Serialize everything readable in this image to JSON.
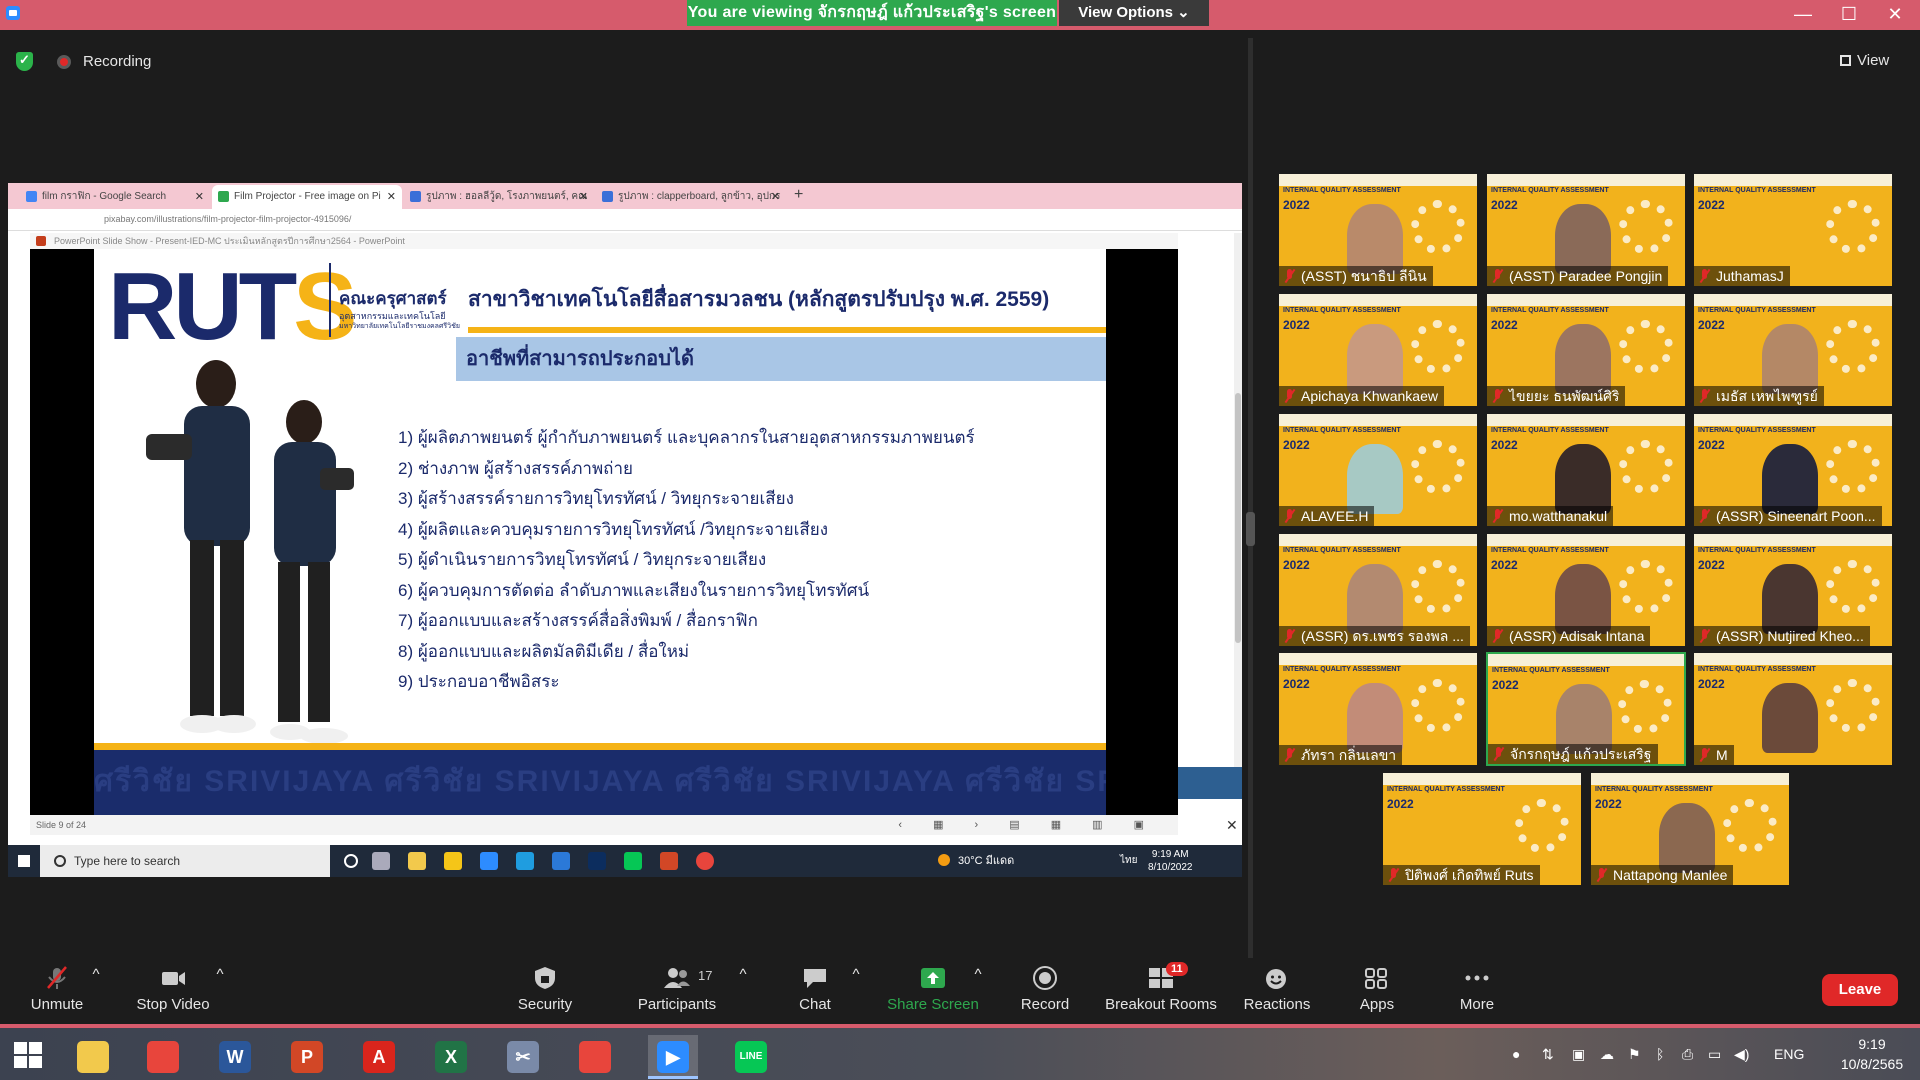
{
  "window": {
    "viewing_banner": "You are viewing จักรกฤษฎ์ แก้วประเสริฐ's screen",
    "view_options": "View Options"
  },
  "meeting": {
    "recording_label": "Recording",
    "view_label": "View"
  },
  "shared_screen": {
    "browser_tabs": [
      {
        "label": "film กราฟิก - Google Search",
        "icon_color": "#4285f4"
      },
      {
        "label": "Film Projector - Free image on Pi",
        "icon_color": "#2ea84e"
      },
      {
        "label": "รูปภาพ : ฮอลลีวู้ด, โรงภาพยนตร์, คณ",
        "icon_color": "#3b6fd8"
      },
      {
        "label": "รูปภาพ : clapperboard, ลูกข้าว, อุปกร",
        "icon_color": "#3b6fd8"
      }
    ],
    "address": "pixabay.com/illustrations/film-projector-film-projector-4915096/",
    "ppt_title": "PowerPoint Slide Show - Present-IED-MC ประเมินหลักสูตรปีการศึกษา2564 - PowerPoint",
    "slide": {
      "logo_main": "RUT",
      "logo_accent": "S",
      "faculty_title": "คณะครุศาสตร์",
      "faculty_sub": "อุตสาหกรรมและเทคโนโลยี",
      "faculty_uni": "มหาวิทยาลัยเทคโนโลยีราชมงคลศรีวิชัย",
      "program_title": "สาขาวิชาเทคโนโลยีสื่อสารมวลชน (หลักสูตรปรับปรุง พ.ศ. 2559)",
      "careers_heading": "อาชีพที่สามารถประกอบได้",
      "careers": [
        "1) ผู้ผลิตภาพยนตร์ ผู้กำกับภาพยนตร์ และบุคลากรในสายอุตสาหกรรมภาพยนตร์",
        "2) ช่างภาพ ผู้สร้างสรรค์ภาพถ่าย",
        "3) ผู้สร้างสรรค์รายการวิทยุโทรทัศน์ / วิทยุกระจายเสียง",
        "4) ผู้ผลิตและควบคุมรายการวิทยุโทรทัศน์ /วิทยุกระจายเสียง",
        "5) ผู้ดำเนินรายการวิทยุโทรทัศน์ / วิทยุกระจายเสียง",
        "6) ผู้ควบคุมการตัดต่อ ลำดับภาพและเสียงในรายการวิทยุโทรทัศน์",
        "7) ผู้ออกแบบและสร้างสรรค์สื่อสิ่งพิมพ์ / สื่อกราฟิก",
        "8) ผู้ออกแบบและผลิตมัลติมีเดีย / สื่อใหม่",
        "9) ประกอบอาชีพอิสระ"
      ],
      "watermark": "ศรีวิชัย SRIVIJAYA ศรีวิชัย SRIVIJAYA ศรีวิชัย SRIVIJAYA ศรีวิชัย SRIVIJAYA"
    },
    "slide_counter": "Slide 9 of 24",
    "inner_taskbar": {
      "search_placeholder": "Type here to search",
      "weather": "30°C มีแดด",
      "lang": "ไทย",
      "time": "9:19 AM",
      "date": "8/10/2022"
    }
  },
  "participants": [
    {
      "name": "(ASST) ชนาธิป ลีนิน",
      "skin": "#b98a6a",
      "active": false
    },
    {
      "name": "(ASST) Paradee Pongjin",
      "skin": "#8a6a58",
      "active": false
    },
    {
      "name": "JuthamasJ",
      "skin": "",
      "active": false
    },
    {
      "name": "Apichaya Khwankaew",
      "skin": "#c99a7e",
      "active": false
    },
    {
      "name": "ไขยยะ ธนพัฒน์ศิริ",
      "skin": "#9c7560",
      "active": false
    },
    {
      "name": "เมธัส เหพไพฑูรย์",
      "skin": "#b48866",
      "active": false
    },
    {
      "name": "ALAVEE.H",
      "skin": "#a7c9c4",
      "active": false
    },
    {
      "name": "mo.watthanakul",
      "skin": "#3a2c28",
      "active": false
    },
    {
      "name": "(ASSR) Sineenart Poon...",
      "skin": "#2a2a3a",
      "active": false
    },
    {
      "name": "(ASSR) ดร.เพชร รองพล ...",
      "skin": "#b38a70",
      "active": false
    },
    {
      "name": "(ASSR) Adisak Intana",
      "skin": "#7a5444",
      "active": false
    },
    {
      "name": "(ASSR) Nutjired Kheo...",
      "skin": "#4a3630",
      "active": false
    },
    {
      "name": "ภัทรา กลิ่นเลขา",
      "skin": "#c28c78",
      "active": false
    },
    {
      "name": "จักรกฤษฎ์ แก้วประเสริฐ",
      "skin": "#a8836a",
      "active": true
    },
    {
      "name": "M",
      "skin": "#6b4a3a",
      "active": false
    },
    {
      "name": "ปิติพงศ์ เกิดทิพย์ Ruts",
      "skin": "",
      "active": false
    },
    {
      "name": "Nattapong Manlee",
      "skin": "#8b6850",
      "active": false
    }
  ],
  "tile_text": {
    "header": "INTERNAL QUALITY ASSESSMENT",
    "year": "2022"
  },
  "toolbar": {
    "unmute": "Unmute",
    "stop_video": "Stop Video",
    "security": "Security",
    "participants": "Participants",
    "participant_count": "17",
    "chat": "Chat",
    "share_screen": "Share Screen",
    "record": "Record",
    "breakout_rooms": "Breakout Rooms",
    "breakout_badge": "11",
    "reactions": "Reactions",
    "apps": "Apps",
    "more": "More",
    "leave": "Leave"
  },
  "taskbar": {
    "apps": [
      {
        "name": "file-explorer",
        "color": "#f2c94c",
        "glyph": ""
      },
      {
        "name": "chrome-profile",
        "color": "#e8453c",
        "glyph": ""
      },
      {
        "name": "word",
        "color": "#2b579a",
        "glyph": "W"
      },
      {
        "name": "powerpoint",
        "color": "#d24726",
        "glyph": "P"
      },
      {
        "name": "acrobat",
        "color": "#d9251c",
        "glyph": "A"
      },
      {
        "name": "excel",
        "color": "#217346",
        "glyph": "X"
      },
      {
        "name": "snipping-tool",
        "color": "#7a8aa8",
        "glyph": "✂"
      },
      {
        "name": "chrome",
        "color": "#e8453c",
        "glyph": ""
      },
      {
        "name": "zoom",
        "color": "#2d8cff",
        "glyph": "▶"
      },
      {
        "name": "line",
        "color": "#06c755",
        "glyph": "LINE"
      }
    ],
    "lang": "ENG",
    "time": "9:19",
    "date": "10/8/2565"
  }
}
